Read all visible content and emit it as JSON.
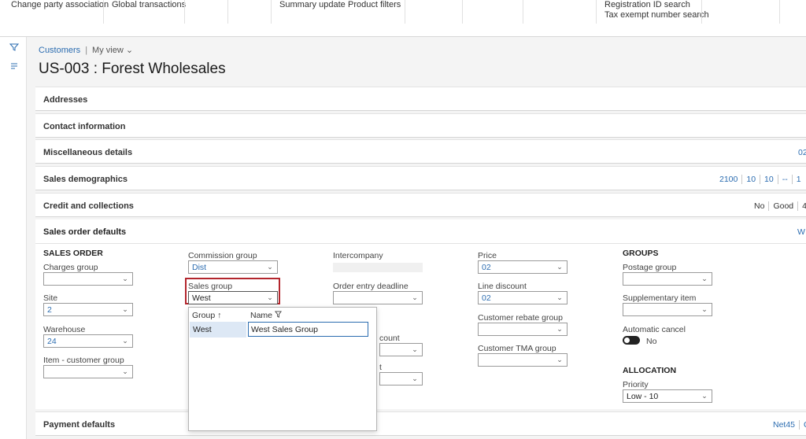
{
  "ribbon": {
    "items": [
      "Change party association",
      "Global transactions",
      "Summary update",
      "Product filters",
      "Registration ID search",
      "Tax exempt number search"
    ]
  },
  "rail": {
    "icons": [
      "filter-icon",
      "list-icon"
    ]
  },
  "breadcrumb": {
    "link": "Customers",
    "view": "My view"
  },
  "page_title": "US-003 : Forest Wholesales",
  "fasttabs": {
    "addresses": "Addresses",
    "contact": "Contact information",
    "misc": {
      "title": "Miscellaneous details",
      "summary": [
        "02"
      ]
    },
    "demographics": {
      "title": "Sales demographics",
      "summary": [
        "2100",
        "10",
        "10",
        "--",
        "1"
      ]
    },
    "credit": {
      "title": "Credit and collections",
      "summary": [
        "No",
        "Good",
        "4"
      ]
    },
    "sales_order_defaults": {
      "title": "Sales order defaults",
      "summary": [
        "W"
      ]
    },
    "payment": {
      "title": "Payment defaults",
      "summary": [
        "Net45",
        "CH"
      ]
    }
  },
  "sales_order": {
    "heading": "SALES ORDER",
    "charges_group_label": "Charges group",
    "charges_group_value": "",
    "site_label": "Site",
    "site_value": "2",
    "warehouse_label": "Warehouse",
    "warehouse_value": "24",
    "item_customer_group_label": "Item - customer group",
    "item_customer_group_value": ""
  },
  "col2": {
    "commission_group_label": "Commission group",
    "commission_group_value": "Dist",
    "sales_group_label": "Sales group",
    "sales_group_value": "West"
  },
  "col3": {
    "intercompany_label": "Intercompany",
    "order_entry_deadline_label": "Order entry deadline",
    "order_entry_deadline_value": "",
    "partial_label_1": "count",
    "partial_label_2": "t"
  },
  "col4": {
    "price_label": "Price",
    "price_value": "02",
    "line_discount_label": "Line discount",
    "line_discount_value": "02",
    "customer_rebate_group_label": "Customer rebate group",
    "customer_rebate_group_value": "",
    "customer_tma_group_label": "Customer TMA group",
    "customer_tma_group_value": ""
  },
  "col5": {
    "groups_heading": "GROUPS",
    "postage_group_label": "Postage group",
    "postage_group_value": "",
    "supplementary_item_label": "Supplementary item",
    "supplementary_item_value": "",
    "automatic_cancel_label": "Automatic cancel",
    "automatic_cancel_value": "No",
    "allocation_heading": "ALLOCATION",
    "priority_label": "Priority",
    "priority_value": "Low - 10"
  },
  "lookup": {
    "col_group": "Group",
    "col_name": "Name",
    "rows": [
      {
        "group": "West",
        "name": "West Sales Group"
      }
    ]
  },
  "icons": {
    "chevron": "chevron-down-icon",
    "sort": "sort-ascending-icon",
    "filter": "filter-icon"
  },
  "colors": {
    "accent": "#2b6cb0",
    "highlight": "#b3262d"
  }
}
